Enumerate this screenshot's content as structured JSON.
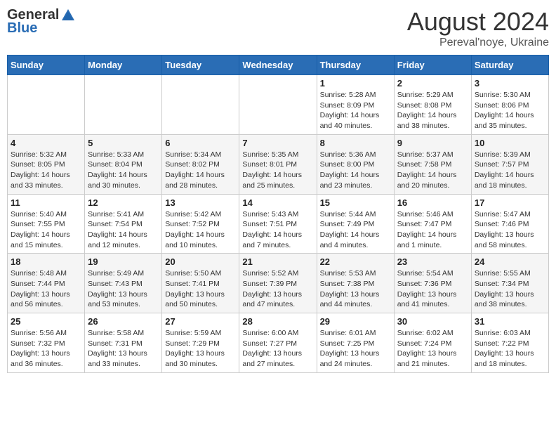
{
  "logo": {
    "general": "General",
    "blue": "Blue"
  },
  "title": "August 2024",
  "subtitle": "Pereval'noye, Ukraine",
  "days_header": [
    "Sunday",
    "Monday",
    "Tuesday",
    "Wednesday",
    "Thursday",
    "Friday",
    "Saturday"
  ],
  "weeks": [
    [
      {
        "day": "",
        "info": ""
      },
      {
        "day": "",
        "info": ""
      },
      {
        "day": "",
        "info": ""
      },
      {
        "day": "",
        "info": ""
      },
      {
        "day": "1",
        "info": "Sunrise: 5:28 AM\nSunset: 8:09 PM\nDaylight: 14 hours\nand 40 minutes."
      },
      {
        "day": "2",
        "info": "Sunrise: 5:29 AM\nSunset: 8:08 PM\nDaylight: 14 hours\nand 38 minutes."
      },
      {
        "day": "3",
        "info": "Sunrise: 5:30 AM\nSunset: 8:06 PM\nDaylight: 14 hours\nand 35 minutes."
      }
    ],
    [
      {
        "day": "4",
        "info": "Sunrise: 5:32 AM\nSunset: 8:05 PM\nDaylight: 14 hours\nand 33 minutes."
      },
      {
        "day": "5",
        "info": "Sunrise: 5:33 AM\nSunset: 8:04 PM\nDaylight: 14 hours\nand 30 minutes."
      },
      {
        "day": "6",
        "info": "Sunrise: 5:34 AM\nSunset: 8:02 PM\nDaylight: 14 hours\nand 28 minutes."
      },
      {
        "day": "7",
        "info": "Sunrise: 5:35 AM\nSunset: 8:01 PM\nDaylight: 14 hours\nand 25 minutes."
      },
      {
        "day": "8",
        "info": "Sunrise: 5:36 AM\nSunset: 8:00 PM\nDaylight: 14 hours\nand 23 minutes."
      },
      {
        "day": "9",
        "info": "Sunrise: 5:37 AM\nSunset: 7:58 PM\nDaylight: 14 hours\nand 20 minutes."
      },
      {
        "day": "10",
        "info": "Sunrise: 5:39 AM\nSunset: 7:57 PM\nDaylight: 14 hours\nand 18 minutes."
      }
    ],
    [
      {
        "day": "11",
        "info": "Sunrise: 5:40 AM\nSunset: 7:55 PM\nDaylight: 14 hours\nand 15 minutes."
      },
      {
        "day": "12",
        "info": "Sunrise: 5:41 AM\nSunset: 7:54 PM\nDaylight: 14 hours\nand 12 minutes."
      },
      {
        "day": "13",
        "info": "Sunrise: 5:42 AM\nSunset: 7:52 PM\nDaylight: 14 hours\nand 10 minutes."
      },
      {
        "day": "14",
        "info": "Sunrise: 5:43 AM\nSunset: 7:51 PM\nDaylight: 14 hours\nand 7 minutes."
      },
      {
        "day": "15",
        "info": "Sunrise: 5:44 AM\nSunset: 7:49 PM\nDaylight: 14 hours\nand 4 minutes."
      },
      {
        "day": "16",
        "info": "Sunrise: 5:46 AM\nSunset: 7:47 PM\nDaylight: 14 hours\nand 1 minute."
      },
      {
        "day": "17",
        "info": "Sunrise: 5:47 AM\nSunset: 7:46 PM\nDaylight: 13 hours\nand 58 minutes."
      }
    ],
    [
      {
        "day": "18",
        "info": "Sunrise: 5:48 AM\nSunset: 7:44 PM\nDaylight: 13 hours\nand 56 minutes."
      },
      {
        "day": "19",
        "info": "Sunrise: 5:49 AM\nSunset: 7:43 PM\nDaylight: 13 hours\nand 53 minutes."
      },
      {
        "day": "20",
        "info": "Sunrise: 5:50 AM\nSunset: 7:41 PM\nDaylight: 13 hours\nand 50 minutes."
      },
      {
        "day": "21",
        "info": "Sunrise: 5:52 AM\nSunset: 7:39 PM\nDaylight: 13 hours\nand 47 minutes."
      },
      {
        "day": "22",
        "info": "Sunrise: 5:53 AM\nSunset: 7:38 PM\nDaylight: 13 hours\nand 44 minutes."
      },
      {
        "day": "23",
        "info": "Sunrise: 5:54 AM\nSunset: 7:36 PM\nDaylight: 13 hours\nand 41 minutes."
      },
      {
        "day": "24",
        "info": "Sunrise: 5:55 AM\nSunset: 7:34 PM\nDaylight: 13 hours\nand 38 minutes."
      }
    ],
    [
      {
        "day": "25",
        "info": "Sunrise: 5:56 AM\nSunset: 7:32 PM\nDaylight: 13 hours\nand 36 minutes."
      },
      {
        "day": "26",
        "info": "Sunrise: 5:58 AM\nSunset: 7:31 PM\nDaylight: 13 hours\nand 33 minutes."
      },
      {
        "day": "27",
        "info": "Sunrise: 5:59 AM\nSunset: 7:29 PM\nDaylight: 13 hours\nand 30 minutes."
      },
      {
        "day": "28",
        "info": "Sunrise: 6:00 AM\nSunset: 7:27 PM\nDaylight: 13 hours\nand 27 minutes."
      },
      {
        "day": "29",
        "info": "Sunrise: 6:01 AM\nSunset: 7:25 PM\nDaylight: 13 hours\nand 24 minutes."
      },
      {
        "day": "30",
        "info": "Sunrise: 6:02 AM\nSunset: 7:24 PM\nDaylight: 13 hours\nand 21 minutes."
      },
      {
        "day": "31",
        "info": "Sunrise: 6:03 AM\nSunset: 7:22 PM\nDaylight: 13 hours\nand 18 minutes."
      }
    ]
  ]
}
